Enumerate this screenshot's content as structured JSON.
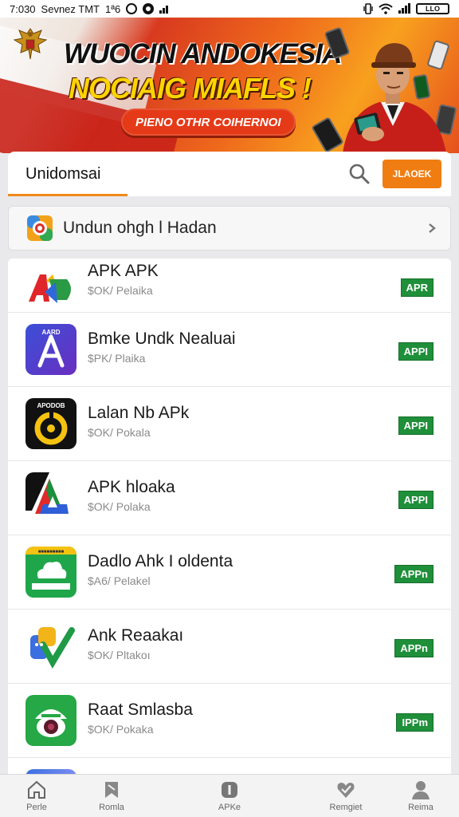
{
  "status_bar": {
    "time": "7:030",
    "carrier": "Sevnez TMT",
    "extra": "1ª6",
    "battery": "LLO"
  },
  "banner": {
    "title": "WUOCIN ANDOKESIA",
    "subtitle": "NOCIAIG MIAFLS !",
    "pill_text": "PIENO OTHR COIHERNOI"
  },
  "search": {
    "value": "Unidomsai",
    "button_label": "JLAOEK",
    "accent_color": "#f07d12"
  },
  "category": {
    "label": "Undun ohgh l Hadan"
  },
  "apps": [
    {
      "name": "APK APK",
      "meta": "$OK/ Pelaika",
      "badge": "APR",
      "icon": "ad-logo-icon"
    },
    {
      "name": "Bmke Undk Nealuai",
      "meta": "$PK/ Plaika",
      "badge": "APPI",
      "icon": "triangle-a-icon"
    },
    {
      "name": "Lalan Nb APk",
      "meta": "$OK/ Pokala",
      "badge": "APPI",
      "icon": "ring-icon"
    },
    {
      "name": "APK hloaka",
      "meta": "$OK/ Polaka",
      "badge": "APPI",
      "icon": "tricolor-a-icon"
    },
    {
      "name": "Dadlo Ahk I oldenta",
      "meta": "$A6/ Pelakel",
      "badge": "APPn",
      "icon": "cloud-icon"
    },
    {
      "name": "Ank Reaakaı",
      "meta": "$OK/ Pltakoı",
      "badge": "APPn",
      "icon": "check-tiles-icon"
    },
    {
      "name": "Raat Smlasba",
      "meta": "$OK/ Pokaka",
      "badge": "IPPm",
      "icon": "eye-icon"
    }
  ],
  "bottom_nav": [
    {
      "label": "Perle",
      "icon": "home-icon"
    },
    {
      "label": "Romla",
      "icon": "bookmark-icon"
    },
    {
      "label": "APKe",
      "icon": "info-icon"
    },
    {
      "label": "Remgiet",
      "icon": "heart-check-icon"
    },
    {
      "label": "Reima",
      "icon": "person-icon"
    }
  ]
}
